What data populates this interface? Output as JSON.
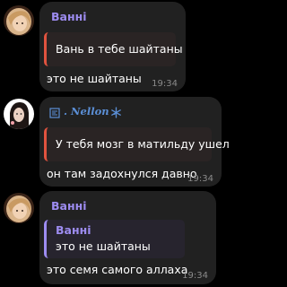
{
  "colors": {
    "background": "#000000",
    "bubble": "#212121",
    "vanni_accent": "#9d8cf0",
    "nellon_accent": "#5b8fd6",
    "quote_red": "#e0533f",
    "timestamp": "#8a8a8a"
  },
  "messages": [
    {
      "sender": "Ванні",
      "avatar": "avatar-blonde-girl",
      "reply": {
        "text": "Вань в тебе шайтаны"
      },
      "text": "это не шайтаны",
      "time": "19:34"
    },
    {
      "sender": ". Nellon .",
      "avatar": "avatar-dark-hair-girl",
      "reply": {
        "text": "У тебя мозг в матильду ушел"
      },
      "text": "он там задохнулся давно",
      "time": "19:34"
    },
    {
      "sender": "Ванні",
      "avatar": "avatar-blonde-girl",
      "reply": {
        "author": "Ванні",
        "text": "это не шайтаны"
      },
      "text": "это семя самого аллаха",
      "time": "19:34"
    }
  ]
}
